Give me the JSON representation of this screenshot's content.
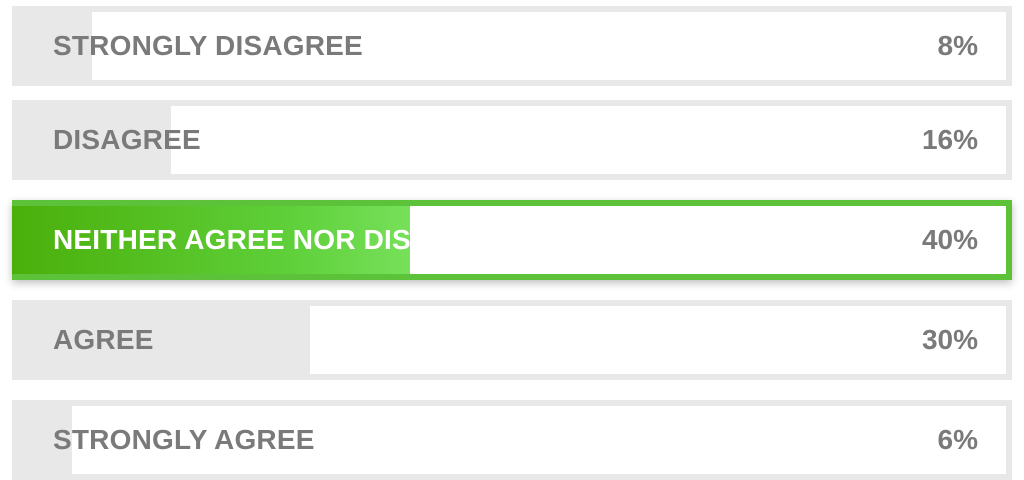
{
  "poll": {
    "options": [
      {
        "label": "STRONGLY DISAGREE",
        "percent_text": "8%",
        "percent": 8,
        "selected": false
      },
      {
        "label": "DISAGREE",
        "percent_text": "16%",
        "percent": 16,
        "selected": false
      },
      {
        "label": "NEITHER AGREE NOR DISAGREE",
        "percent_text": "40%",
        "percent": 40,
        "selected": true
      },
      {
        "label": "AGREE",
        "percent_text": "30%",
        "percent": 30,
        "selected": false
      },
      {
        "label": "STRONGLY AGREE",
        "percent_text": "6%",
        "percent": 6,
        "selected": false
      }
    ],
    "colors": {
      "track": "#e8e8e8",
      "text": "#7a7a7a",
      "selected_gradient_start": "#4aaf0a",
      "selected_gradient_end": "#77e05a",
      "selected_border": "#5cc23a"
    }
  }
}
